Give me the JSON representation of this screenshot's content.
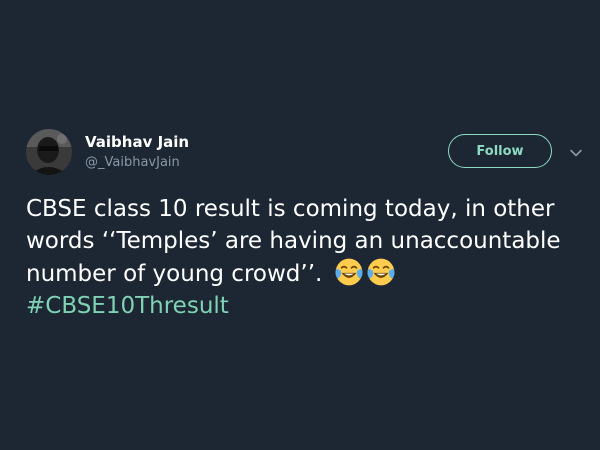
{
  "user": {
    "name": "Vaibhav Jain",
    "handle": "@_VaibhavJain"
  },
  "follow_label": "Follow",
  "tweet": {
    "line1": "CBSE class 10 result is coming today, in other",
    "line2": "words ‘‘Temples’ are having an unaccountable",
    "line3": "number of young crowd’’.",
    "hashtag": "#CBSE10Thresult",
    "emojis": [
      "face-with-tears-of-joy-emoji",
      "face-with-tears-of-joy-emoji"
    ]
  },
  "colors": {
    "background": "#1c2733",
    "accent": "#8ed9c1",
    "hashtag": "#7fd2b3",
    "muted": "#8899a6"
  }
}
